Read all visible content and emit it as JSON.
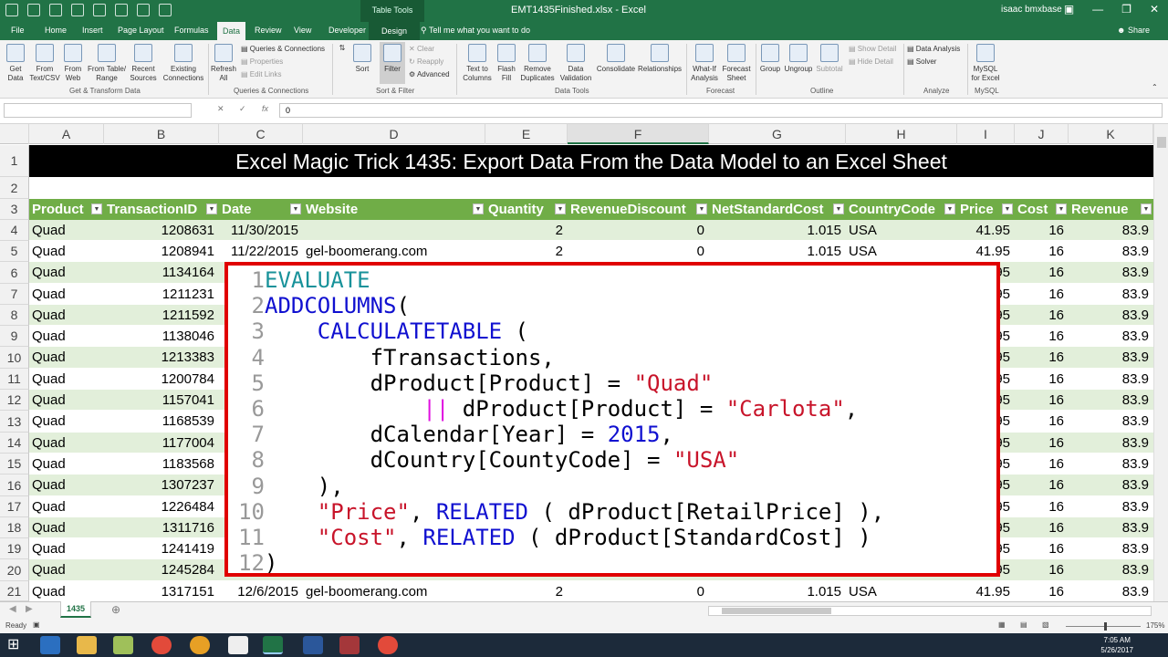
{
  "window": {
    "title": "EMT1435Finished.xlsx - Excel",
    "context_group": "Table Tools",
    "user": "isaac bmxbase"
  },
  "tabs": [
    "File",
    "Home",
    "Insert",
    "Page Layout",
    "Formulas",
    "Data",
    "Review",
    "View",
    "Developer",
    "Design"
  ],
  "tell_me": "Tell me what you want to do",
  "share": "Share",
  "ribbon": {
    "buttons": {
      "get_data": "Get Data",
      "from_text": "From Text/CSV",
      "from_web": "From Web",
      "from_table": "From Table/ Range",
      "recent_sources": "Recent Sources",
      "existing_connections": "Existing Connections",
      "refresh_all": "Refresh All",
      "sort": "Sort",
      "filter": "Filter",
      "text_to_columns": "Text to Columns",
      "flash_fill": "Flash Fill",
      "remove_duplicates": "Remove Duplicates",
      "data_validation": "Data Validation",
      "consolidate": "Consolidate",
      "relationships": "Relationships",
      "what_if": "What-If Analysis",
      "forecast_sheet": "Forecast Sheet",
      "group": "Group",
      "ungroup": "Ungroup",
      "subtotal": "Subtotal",
      "mysql": "MySQL for Excel"
    },
    "small": {
      "queries": "Queries & Connections",
      "properties": "Properties",
      "edit_links": "Edit Links",
      "clear": "Clear",
      "reapply": "Reapply",
      "advanced": "Advanced",
      "show_detail": "Show Detail",
      "hide_detail": "Hide Detail",
      "data_analysis": "Data Analysis",
      "solver": "Solver"
    },
    "groups": [
      "Get & Transform Data",
      "Queries & Connections",
      "Sort & Filter",
      "Data Tools",
      "Forecast",
      "Outline",
      "Analyze",
      "MySQL"
    ]
  },
  "formula_bar": {
    "name_box": "",
    "fx": "fx",
    "value": "0"
  },
  "columns": [
    "A",
    "B",
    "C",
    "D",
    "E",
    "F",
    "G",
    "H",
    "I",
    "J",
    "K"
  ],
  "rows": [
    "1",
    "2",
    "3",
    "4",
    "5",
    "6",
    "7",
    "8",
    "9",
    "10",
    "11",
    "12",
    "13",
    "14",
    "15",
    "16",
    "17",
    "18",
    "19",
    "20",
    "21"
  ],
  "banner_title": "Excel Magic Trick 1435: Export Data From the Data Model to an Excel Sheet",
  "headers": [
    "Product",
    "TransactionID",
    "Date",
    "Website",
    "Quantity",
    "RevenueDiscount",
    "NetStandardCost",
    "CountryCode",
    "Price",
    "Cost",
    "Revenue"
  ],
  "data_rows": [
    [
      "Quad",
      "1208631",
      "11/30/2015",
      "",
      "2",
      "0",
      "1.015",
      "USA",
      "41.95",
      "16",
      "83.9"
    ],
    [
      "Quad",
      "1208941",
      "11/22/2015",
      "gel-boomerang.com",
      "2",
      "0",
      "1.015",
      "USA",
      "41.95",
      "16",
      "83.9"
    ],
    [
      "Quad",
      "1134164",
      "",
      "",
      "",
      "",
      "",
      "",
      "95",
      "16",
      "83.9"
    ],
    [
      "Quad",
      "1211231",
      "",
      "",
      "",
      "",
      "",
      "",
      "95",
      "16",
      "83.9"
    ],
    [
      "Quad",
      "1211592",
      "",
      "",
      "",
      "",
      "",
      "",
      "95",
      "16",
      "83.9"
    ],
    [
      "Quad",
      "1138046",
      "",
      "",
      "",
      "",
      "",
      "",
      "95",
      "16",
      "83.9"
    ],
    [
      "Quad",
      "1213383",
      "",
      "",
      "",
      "",
      "",
      "",
      "95",
      "16",
      "83.9"
    ],
    [
      "Quad",
      "1200784",
      "",
      "",
      "",
      "",
      "",
      "",
      "95",
      "16",
      "83.9"
    ],
    [
      "Quad",
      "1157041",
      "",
      "",
      "",
      "",
      "",
      "",
      "95",
      "16",
      "83.9"
    ],
    [
      "Quad",
      "1168539",
      "",
      "",
      "",
      "",
      "",
      "",
      "95",
      "16",
      "83.9"
    ],
    [
      "Quad",
      "1177004",
      "",
      "",
      "",
      "",
      "",
      "",
      "95",
      "16",
      "83.9"
    ],
    [
      "Quad",
      "1183568",
      "",
      "",
      "",
      "",
      "",
      "",
      "95",
      "16",
      "83.9"
    ],
    [
      "Quad",
      "1307237",
      "",
      "",
      "",
      "",
      "",
      "",
      "95",
      "16",
      "83.9"
    ],
    [
      "Quad",
      "1226484",
      "",
      "",
      "",
      "",
      "",
      "",
      "95",
      "16",
      "83.9"
    ],
    [
      "Quad",
      "1311716",
      "",
      "",
      "",
      "",
      "",
      "",
      "95",
      "16",
      "83.9"
    ],
    [
      "Quad",
      "1241419",
      "",
      "",
      "",
      "",
      "",
      "",
      "95",
      "16",
      "83.9"
    ],
    [
      "Quad",
      "1245284",
      "",
      "",
      "",
      "",
      "",
      "",
      "95",
      "16",
      "83.9"
    ],
    [
      "Quad",
      "1317151",
      "12/6/2015",
      "gel-boomerang.com",
      "2",
      "0",
      "1.015",
      "USA",
      "41.95",
      "16",
      "83.9"
    ]
  ],
  "code_lines": [
    [
      [
        "ev",
        "EVALUATE"
      ]
    ],
    [
      [
        "kw",
        "ADDCOLUMNS"
      ],
      [
        "",
        "("
      ]
    ],
    [
      [
        "",
        "    "
      ],
      [
        "kw",
        "CALCULATETABLE"
      ],
      [
        "",
        " ("
      ]
    ],
    [
      [
        "",
        "        fTransactions,"
      ]
    ],
    [
      [
        "",
        "        dProduct[Product] = "
      ],
      [
        "str",
        "\"Quad\""
      ]
    ],
    [
      [
        "",
        "            "
      ],
      [
        "pp",
        "||"
      ],
      [
        "",
        " dProduct[Product] = "
      ],
      [
        "str",
        "\"Carlota\""
      ],
      [
        "",
        ","
      ]
    ],
    [
      [
        "",
        "        dCalendar[Year] = "
      ],
      [
        "num",
        "2015"
      ],
      [
        "",
        ","
      ]
    ],
    [
      [
        "",
        "        dCountry[CountyCode] = "
      ],
      [
        "str",
        "\"USA\""
      ]
    ],
    [
      [
        "",
        "    ),"
      ]
    ],
    [
      [
        "",
        "    "
      ],
      [
        "str",
        "\"Price\""
      ],
      [
        "",
        ", "
      ],
      [
        "kw",
        "RELATED"
      ],
      [
        "",
        " ( dProduct[RetailPrice] ),"
      ]
    ],
    [
      [
        "",
        "    "
      ],
      [
        "str",
        "\"Cost\""
      ],
      [
        "",
        ", "
      ],
      [
        "kw",
        "RELATED"
      ],
      [
        "",
        " ( dProduct[StandardCost] )"
      ]
    ],
    [
      [
        "",
        ")"
      ]
    ]
  ],
  "sheet_tab": "1435",
  "status": {
    "ready": "Ready",
    "zoom": "175%",
    "time": "7:05 AM",
    "date": "5/26/2017"
  }
}
